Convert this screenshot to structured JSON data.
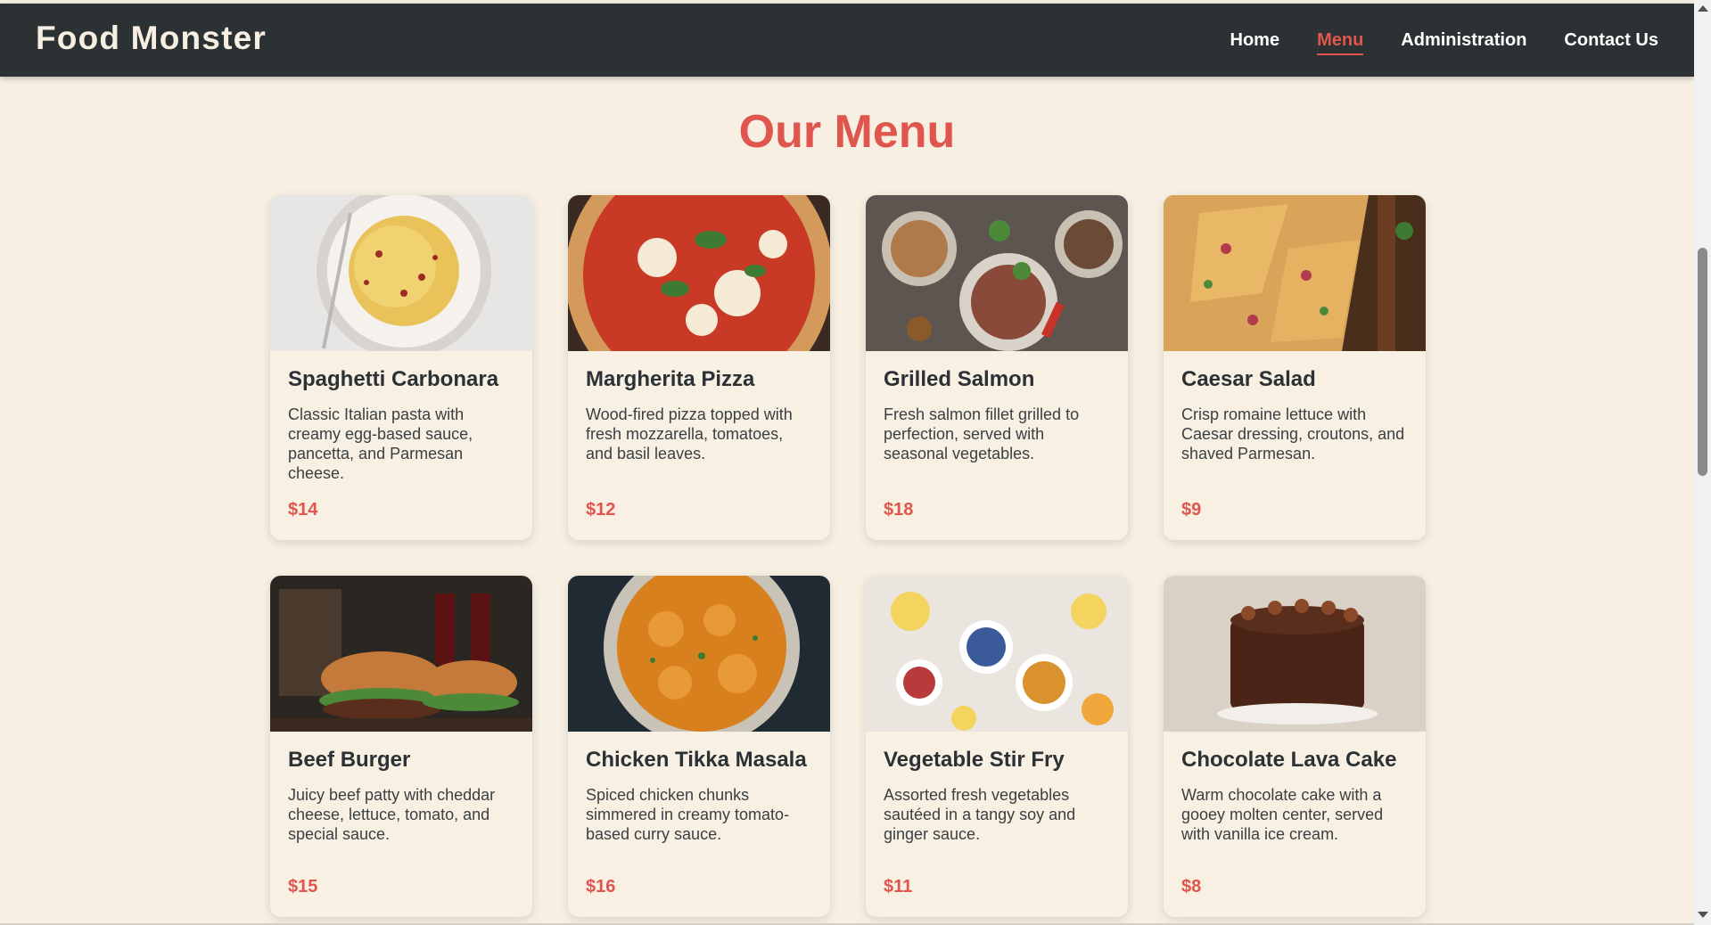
{
  "header": {
    "brand": "Food Monster",
    "nav": [
      {
        "label": "Home",
        "active": false
      },
      {
        "label": "Menu",
        "active": true
      },
      {
        "label": "Administration",
        "active": false
      },
      {
        "label": "Contact Us",
        "active": false
      }
    ]
  },
  "main": {
    "title": "Our Menu",
    "items": [
      {
        "name": "Spaghetti Carbonara",
        "description": "Classic Italian pasta with creamy egg-based sauce, pancetta, and Parmesan cheese.",
        "price": "$14"
      },
      {
        "name": "Margherita Pizza",
        "description": "Wood-fired pizza topped with fresh mozzarella, tomatoes, and basil leaves.",
        "price": "$12"
      },
      {
        "name": "Grilled Salmon",
        "description": "Fresh salmon fillet grilled to perfection, served with seasonal vegetables.",
        "price": "$18"
      },
      {
        "name": "Caesar Salad",
        "description": "Crisp romaine lettuce with Caesar dressing, croutons, and shaved Parmesan.",
        "price": "$9"
      },
      {
        "name": "Beef Burger",
        "description": "Juicy beef patty with cheddar cheese, lettuce, tomato, and special sauce.",
        "price": "$15"
      },
      {
        "name": "Chicken Tikka Masala",
        "description": "Spiced chicken chunks simmered in creamy tomato-based curry sauce.",
        "price": "$16"
      },
      {
        "name": "Vegetable Stir Fry",
        "description": "Assorted fresh vegetables sautéed in a tangy soy and ginger sauce.",
        "price": "$11"
      },
      {
        "name": "Chocolate Lava Cake",
        "description": "Warm chocolate cake with a gooey molten center, served with vanilla ice cream.",
        "price": "$8"
      }
    ]
  },
  "colors": {
    "accent": "#e0554d",
    "header_bg": "#2c3234",
    "page_bg": "#f6efe2"
  }
}
